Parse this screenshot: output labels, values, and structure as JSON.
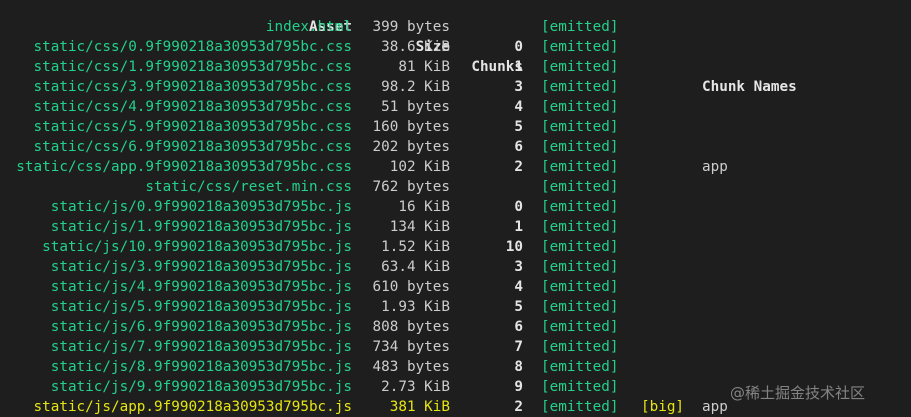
{
  "headers": {
    "asset": "Asset",
    "size": "Size",
    "chunks": "Chunks",
    "chunk_names": "Chunk Names"
  },
  "rows": [
    {
      "asset": "index.html",
      "size": "399 bytes",
      "chunk": "",
      "status": "[emitted]",
      "big": "",
      "name": ""
    },
    {
      "asset": "static/css/0.9f990218a30953d795bc.css",
      "size": "38.6 KiB",
      "chunk": "0",
      "status": "[emitted]",
      "big": "",
      "name": ""
    },
    {
      "asset": "static/css/1.9f990218a30953d795bc.css",
      "size": "81 KiB",
      "chunk": "1",
      "status": "[emitted]",
      "big": "",
      "name": ""
    },
    {
      "asset": "static/css/3.9f990218a30953d795bc.css",
      "size": "98.2 KiB",
      "chunk": "3",
      "status": "[emitted]",
      "big": "",
      "name": ""
    },
    {
      "asset": "static/css/4.9f990218a30953d795bc.css",
      "size": "51 bytes",
      "chunk": "4",
      "status": "[emitted]",
      "big": "",
      "name": ""
    },
    {
      "asset": "static/css/5.9f990218a30953d795bc.css",
      "size": "160 bytes",
      "chunk": "5",
      "status": "[emitted]",
      "big": "",
      "name": ""
    },
    {
      "asset": "static/css/6.9f990218a30953d795bc.css",
      "size": "202 bytes",
      "chunk": "6",
      "status": "[emitted]",
      "big": "",
      "name": ""
    },
    {
      "asset": "static/css/app.9f990218a30953d795bc.css",
      "size": "102 KiB",
      "chunk": "2",
      "status": "[emitted]",
      "big": "",
      "name": "app"
    },
    {
      "asset": "static/css/reset.min.css",
      "size": "762 bytes",
      "chunk": "",
      "status": "[emitted]",
      "big": "",
      "name": ""
    },
    {
      "asset": "static/js/0.9f990218a30953d795bc.js",
      "size": "16 KiB",
      "chunk": "0",
      "status": "[emitted]",
      "big": "",
      "name": ""
    },
    {
      "asset": "static/js/1.9f990218a30953d795bc.js",
      "size": "134 KiB",
      "chunk": "1",
      "status": "[emitted]",
      "big": "",
      "name": ""
    },
    {
      "asset": "static/js/10.9f990218a30953d795bc.js",
      "size": "1.52 KiB",
      "chunk": "10",
      "status": "[emitted]",
      "big": "",
      "name": ""
    },
    {
      "asset": "static/js/3.9f990218a30953d795bc.js",
      "size": "63.4 KiB",
      "chunk": "3",
      "status": "[emitted]",
      "big": "",
      "name": ""
    },
    {
      "asset": "static/js/4.9f990218a30953d795bc.js",
      "size": "610 bytes",
      "chunk": "4",
      "status": "[emitted]",
      "big": "",
      "name": ""
    },
    {
      "asset": "static/js/5.9f990218a30953d795bc.js",
      "size": "1.93 KiB",
      "chunk": "5",
      "status": "[emitted]",
      "big": "",
      "name": ""
    },
    {
      "asset": "static/js/6.9f990218a30953d795bc.js",
      "size": "808 bytes",
      "chunk": "6",
      "status": "[emitted]",
      "big": "",
      "name": ""
    },
    {
      "asset": "static/js/7.9f990218a30953d795bc.js",
      "size": "734 bytes",
      "chunk": "7",
      "status": "[emitted]",
      "big": "",
      "name": ""
    },
    {
      "asset": "static/js/8.9f990218a30953d795bc.js",
      "size": "483 bytes",
      "chunk": "8",
      "status": "[emitted]",
      "big": "",
      "name": ""
    },
    {
      "asset": "static/js/9.9f990218a30953d795bc.js",
      "size": "2.73 KiB",
      "chunk": "9",
      "status": "[emitted]",
      "big": "",
      "name": ""
    },
    {
      "asset": "static/js/app.9f990218a30953d795bc.js",
      "size": "381 KiB",
      "chunk": "2",
      "status": "[emitted]",
      "big": "[big]",
      "name": "app"
    }
  ],
  "watermark": "@稀土掘金技术社区",
  "colors": {
    "background": "#1e1e1e",
    "asset_green": "#23d18b",
    "warning_yellow": "#e5e510",
    "text": "#cccccc"
  }
}
